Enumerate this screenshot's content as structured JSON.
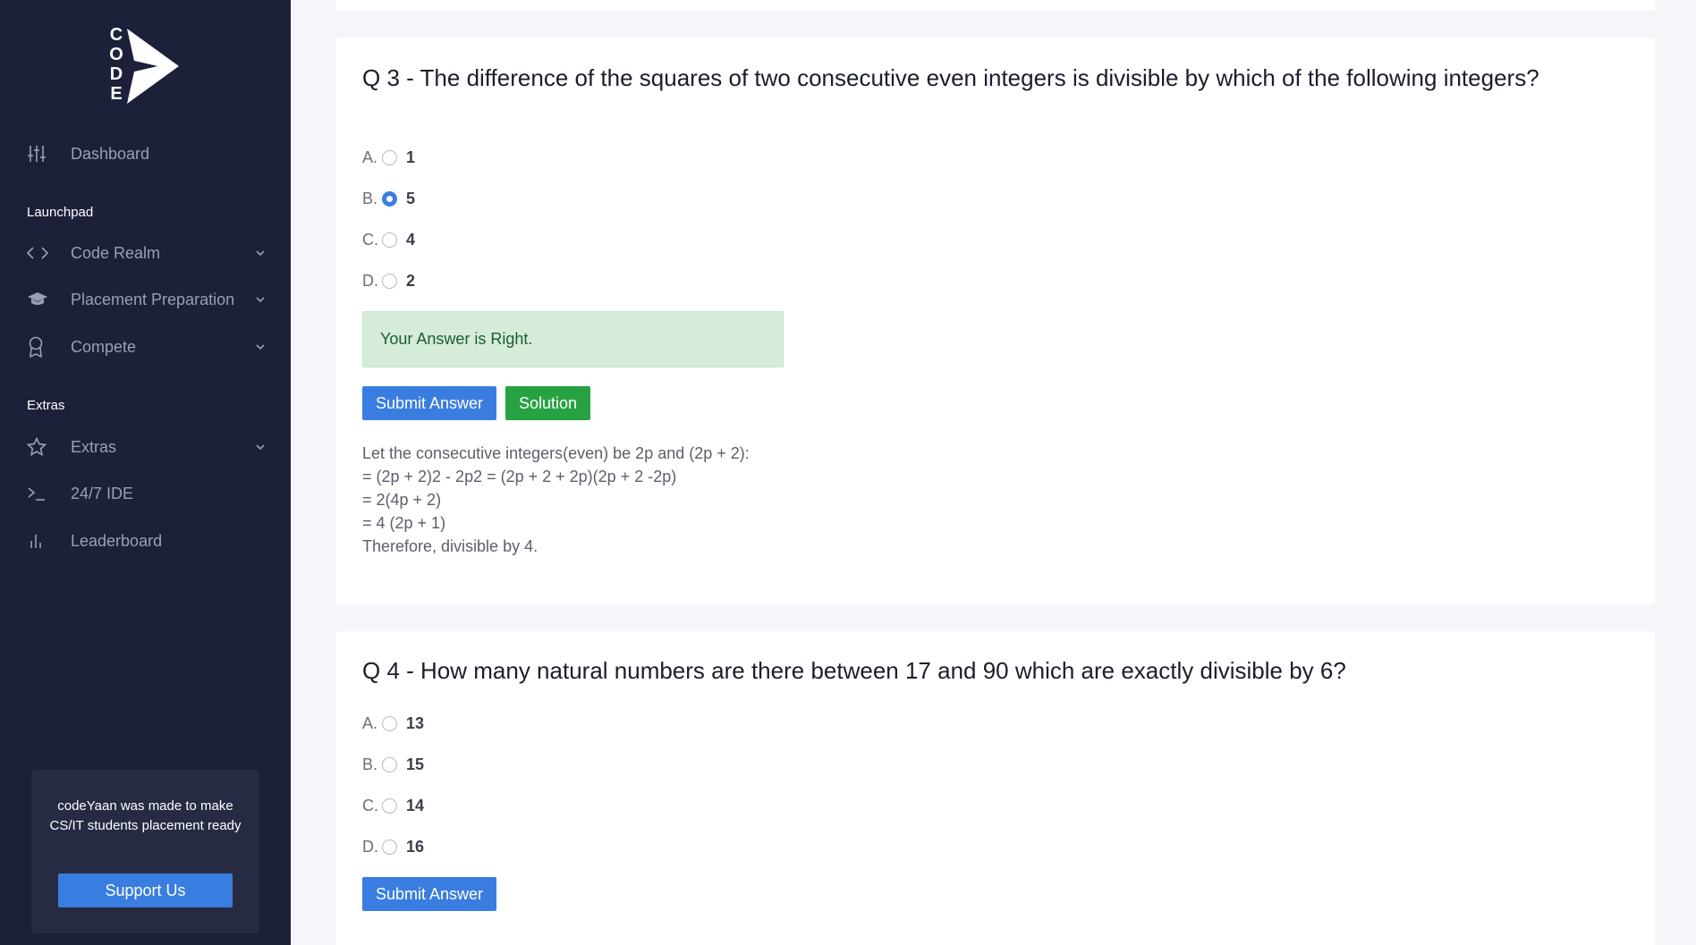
{
  "sidebar": {
    "logo": {
      "letters": [
        "C",
        "O",
        "D",
        "E"
      ]
    },
    "dashboard": {
      "label": "Dashboard",
      "icon": "sliders-icon"
    },
    "launchpad_label": "Launchpad",
    "launchpad_items": [
      {
        "label": "Code Realm",
        "icon": "code-icon"
      },
      {
        "label": "Placement Preparation",
        "icon": "graduation-cap-icon"
      },
      {
        "label": "Compete",
        "icon": "award-icon"
      }
    ],
    "extras_label": "Extras",
    "extras_items": [
      {
        "label": "Extras",
        "icon": "star-icon"
      },
      {
        "label": "24/7 IDE",
        "icon": "terminal-icon"
      },
      {
        "label": "Leaderboard",
        "icon": "bar-chart-icon"
      }
    ],
    "promo": {
      "text": "codeYaan was made to make CS/IT students placement ready",
      "button": "Support Us"
    }
  },
  "questions": [
    {
      "title": "Q 3 - The difference of the squares of two consecutive even integers is divisible by which of the following integers?",
      "options": [
        {
          "letter": "A.",
          "value": "1",
          "selected": false
        },
        {
          "letter": "B.",
          "value": "5",
          "selected": true
        },
        {
          "letter": "C.",
          "value": "4",
          "selected": false
        },
        {
          "letter": "D.",
          "value": "2",
          "selected": false
        }
      ],
      "feedback": "Your Answer is Right.",
      "submit_label": "Submit Answer",
      "solution_label": "Solution",
      "solution_lines": [
        "Let the consecutive integers(even) be 2p and (2p + 2):",
        "= (2p + 2)2 - 2p2 = (2p + 2 + 2p)(2p + 2 -2p)",
        "= 2(4p + 2)",
        "= 4 (2p + 1)",
        "Therefore, divisible by 4."
      ]
    },
    {
      "title": "Q 4 - How many natural numbers are there between 17 and 90 which are exactly divisible by 6?",
      "options": [
        {
          "letter": "A.",
          "value": "13",
          "selected": false
        },
        {
          "letter": "B.",
          "value": "15",
          "selected": false
        },
        {
          "letter": "C.",
          "value": "14",
          "selected": false
        },
        {
          "letter": "D.",
          "value": "16",
          "selected": false
        }
      ],
      "submit_label": "Submit Answer"
    }
  ],
  "colors": {
    "sidebar_bg": "#1c2039",
    "primary": "#3a7de0",
    "success": "#27a243",
    "alert_bg": "#d4ecd9"
  }
}
